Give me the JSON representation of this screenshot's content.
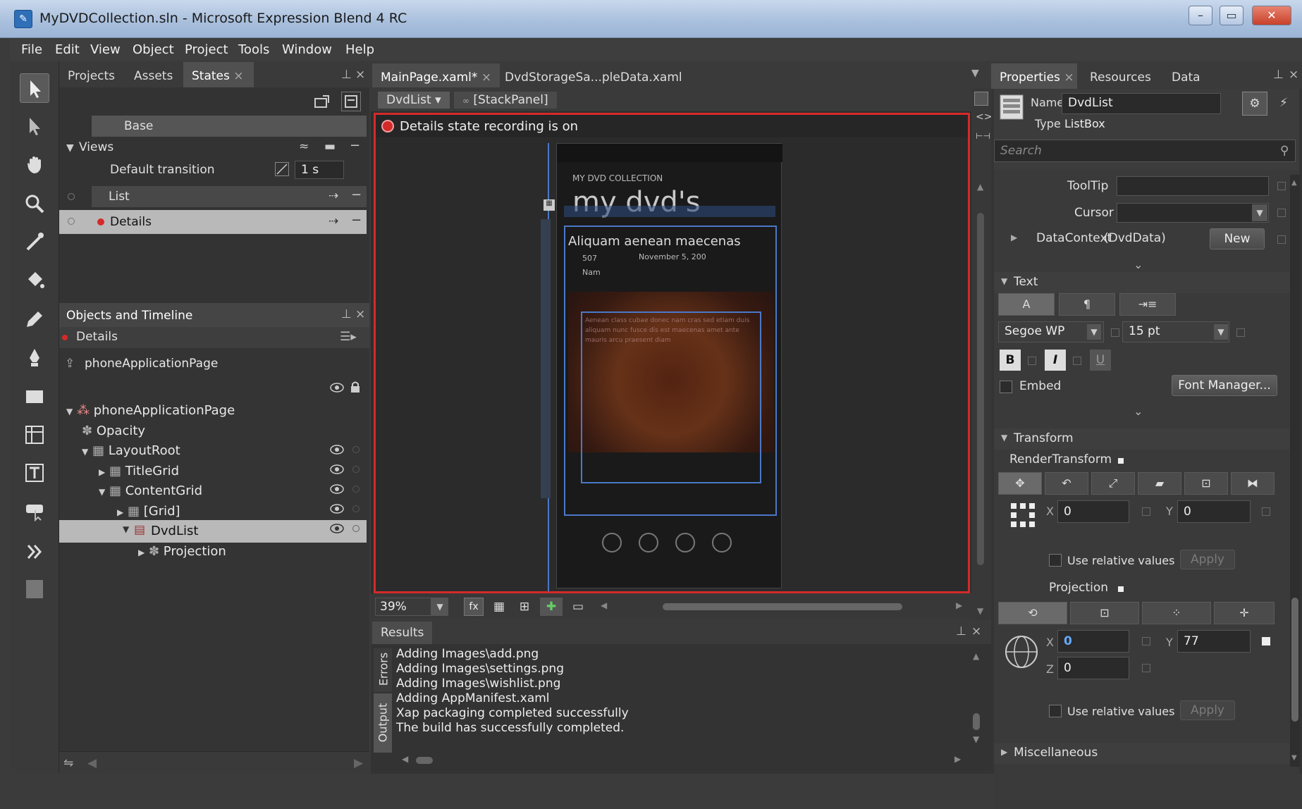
{
  "window": {
    "title": "MyDVDCollection.sln - Microsoft Expression Blend 4 RC",
    "controls": [
      "–",
      "▭",
      "✕"
    ]
  },
  "menu": [
    "File",
    "Edit",
    "View",
    "Object",
    "Project",
    "Tools",
    "Window",
    "Help"
  ],
  "left_panel": {
    "tabs": [
      "Projects",
      "Assets",
      "States"
    ],
    "active_tab": "States",
    "close_glyph": "×",
    "base_label": "Base",
    "views_label": "Views",
    "default_transition": {
      "label": "Default transition",
      "duration": "1 s"
    },
    "states": [
      "List",
      "Details"
    ]
  },
  "objects_panel": {
    "title": "Objects and Timeline",
    "current_state": "Details",
    "scope": "phoneApplicationPage",
    "tree": [
      {
        "label": "phoneApplicationPage",
        "icon": "page-icon"
      },
      {
        "label": "Opacity",
        "icon": "animation-icon"
      },
      {
        "label": "LayoutRoot",
        "icon": "grid-icon"
      },
      {
        "label": "TitleGrid",
        "icon": "grid-icon"
      },
      {
        "label": "ContentGrid",
        "icon": "grid-icon"
      },
      {
        "label": "[Grid]",
        "icon": "grid-icon"
      },
      {
        "label": "DvdList",
        "icon": "listbox-icon"
      },
      {
        "label": "Projection",
        "icon": "animation-icon"
      }
    ]
  },
  "document": {
    "tabs": [
      "MainPage.xaml*",
      "DvdStorageSa...pleData.xaml"
    ],
    "breadcrumb": [
      "DvdList",
      "[StackPanel]"
    ],
    "recording_banner": "Details state recording is on",
    "zoom": "39%"
  },
  "phone": {
    "app_title": "MY DVD COLLECTION",
    "page_title": "my dvd's",
    "item_title": "Aliquam aenean maecenas",
    "item_number": "507",
    "item_date": "November 5, 200",
    "item_sub": "Nam",
    "description": "Aenean class cubae donec nam cras sed etiam duis aliquam nunc fusce dis est maecenas amet ante mauris arcu praesent diam"
  },
  "results": {
    "title": "Results",
    "side_tabs": [
      "Errors",
      "Output"
    ],
    "lines": [
      "Adding Images\\add.png",
      "Adding Images\\settings.png",
      "Adding Images\\wishlist.png",
      "Adding AppManifest.xaml",
      "Xap packaging completed successfully",
      "The build has successfully completed."
    ]
  },
  "properties": {
    "tabs": [
      "Properties",
      "Resources",
      "Data"
    ],
    "name_label": "Name",
    "name_value": "DvdList",
    "type_label": "Type",
    "type_value": "ListBox",
    "search_placeholder": "Search",
    "tooltip_label": "ToolTip",
    "cursor_label": "Cursor",
    "datacontext_label": "DataContext",
    "datacontext_value": "(DvdData)",
    "new_button": "New",
    "text_section": "Text",
    "font_family": "Segoe WP",
    "font_size": "15 pt",
    "bold": "B",
    "italic": "I",
    "underline": "U",
    "embed_label": "Embed",
    "font_manager": "Font Manager...",
    "transform_section": "Transform",
    "render_transform": "RenderTransform",
    "rt_x": "0",
    "rt_y": "0",
    "use_relative": "Use relative values",
    "apply": "Apply",
    "projection_label": "Projection",
    "proj_x": "0",
    "proj_y": "77",
    "proj_z": "0",
    "misc_section": "Miscellaneous",
    "x_label": "X",
    "y_label": "Y",
    "z_label": "Z"
  },
  "colors": {
    "recording": "#d42a2a",
    "selection": "#b9b9b9",
    "phone_accent": "#4a78c8"
  }
}
